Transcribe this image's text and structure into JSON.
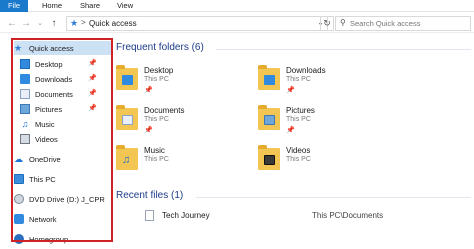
{
  "ribbon": {
    "tabs": [
      "File",
      "Home",
      "Share",
      "View"
    ]
  },
  "address": {
    "current": "Quick access",
    "separator": ">",
    "search_placeholder": "Search Quick access"
  },
  "nav": {
    "quick_access": "Quick access",
    "items": [
      {
        "label": "Desktop",
        "icon": "desktop-icon",
        "pinned": true
      },
      {
        "label": "Downloads",
        "icon": "downloads-icon",
        "pinned": true
      },
      {
        "label": "Documents",
        "icon": "documents-icon",
        "pinned": true
      },
      {
        "label": "Pictures",
        "icon": "pictures-icon",
        "pinned": true
      },
      {
        "label": "Music",
        "icon": "music-icon",
        "pinned": false
      },
      {
        "label": "Videos",
        "icon": "videos-icon",
        "pinned": false
      }
    ],
    "onedrive": "OneDrive",
    "this_pc": "This PC",
    "dvd": "DVD Drive (D:) J_CPR",
    "network": "Network",
    "homegroup": "Homegroup"
  },
  "frequent": {
    "heading": "Frequent folders (6)",
    "folders": [
      {
        "name": "Desktop",
        "location": "This PC",
        "badge_color": "#2f8ae0"
      },
      {
        "name": "Downloads",
        "location": "This PC",
        "badge_color": "#2f8ae0"
      },
      {
        "name": "Documents",
        "location": "This PC",
        "badge_color": "#e9eef7"
      },
      {
        "name": "Pictures",
        "location": "This PC",
        "badge_color": "#6fa6d9"
      },
      {
        "name": "Music",
        "location": "This PC",
        "badge_color": "#1a6fd1"
      },
      {
        "name": "Videos",
        "location": "This PC",
        "badge_color": "#3a3a3a"
      }
    ]
  },
  "recent": {
    "heading": "Recent files (1)",
    "files": [
      {
        "name": "Tech Journey",
        "path": "This PC\\Documents"
      }
    ]
  },
  "colors": {
    "accent": "#1979ca",
    "highlight_border": "#d02127",
    "section_heading": "#1e3b8a",
    "selected_bg": "#cde1f5"
  }
}
